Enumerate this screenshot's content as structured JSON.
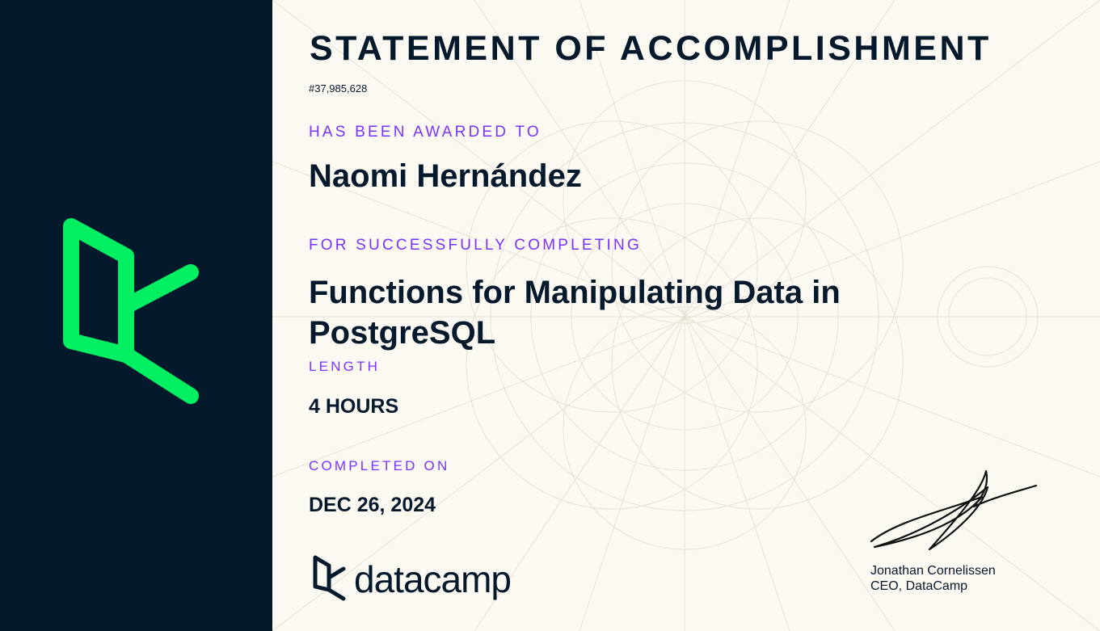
{
  "certificate": {
    "title": "STATEMENT OF ACCOMPLISHMENT",
    "id": "#37,985,628",
    "awarded_label": "HAS BEEN AWARDED TO",
    "recipient": "Naomi Hernández",
    "completing_label": "FOR SUCCESSFULLY COMPLETING",
    "course": "Functions for Manipulating Data in PostgreSQL",
    "length_label": "LENGTH",
    "length_value": "4 HOURS",
    "completed_label": "COMPLETED ON",
    "completed_date": "DEC 26, 2024"
  },
  "brand": {
    "wordmark": "datacamp",
    "logo_icon": "datacamp-logo-icon",
    "accent_color": "#03ef62",
    "dark_color": "#05192d",
    "label_color": "#7933ff"
  },
  "signature": {
    "name": "Jonathan Cornelissen",
    "title": "CEO, DataCamp"
  }
}
